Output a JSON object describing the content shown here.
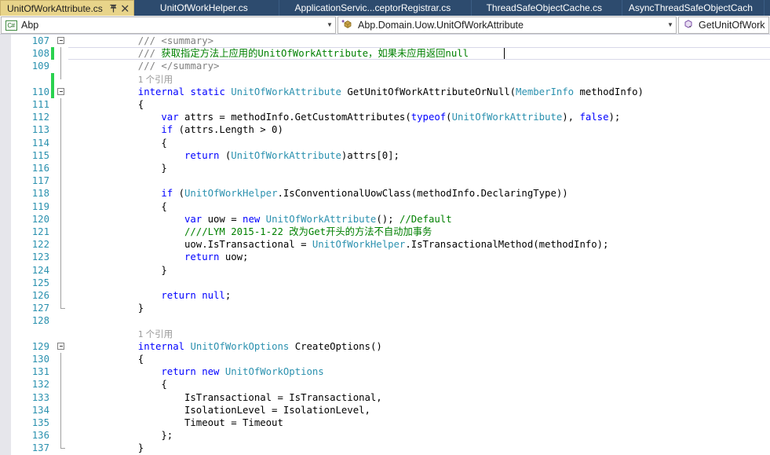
{
  "tabs": [
    {
      "label": "UnitOfWorkAttribute.cs",
      "active": true,
      "icons": [
        "pin-icon",
        "close-icon"
      ]
    },
    {
      "label": "UnitOfWorkHelper.cs",
      "active": false,
      "icons": []
    },
    {
      "label": "ApplicationServic...ceptorRegistrar.cs",
      "active": false,
      "icons": []
    },
    {
      "label": "ThreadSafeObjectCache.cs",
      "active": false,
      "icons": []
    },
    {
      "label": "AsyncThreadSafeObjectCach",
      "active": false,
      "icons": []
    }
  ],
  "navbar": {
    "namespace_combo": {
      "icon": "csharp-project-icon",
      "value": "Abp",
      "arrow": "▼"
    },
    "type_combo": {
      "icon": "class-icon",
      "value": "Abp.Domain.Uow.UnitOfWorkAttribute",
      "arrow": "▼"
    },
    "member_combo": {
      "icon": "method-icon",
      "value": "GetUnitOfWork",
      "arrow": "▼"
    }
  },
  "editor": {
    "language": "C#",
    "caret_line": 108,
    "codelens_label": "个引用",
    "codelens_count": "1",
    "lines": [
      {
        "n": "107",
        "indent": 12,
        "collapse": "minus",
        "rail": false,
        "change": false,
        "tokens": [
          {
            "t": "/// ",
            "c": "doc"
          },
          {
            "t": "<summary>",
            "c": "doc"
          }
        ]
      },
      {
        "n": "108",
        "indent": 12,
        "collapse": null,
        "rail": true,
        "change": true,
        "current": true,
        "tokens": [
          {
            "t": "/// ",
            "c": "doc"
          },
          {
            "t": "获取指定方法上应用的UnitOfWorkAttribute，如果未应用返回null",
            "c": "doctxt"
          }
        ]
      },
      {
        "n": "109",
        "indent": 12,
        "collapse": null,
        "rail": true,
        "change": false,
        "tokens": [
          {
            "t": "/// ",
            "c": "doc"
          },
          {
            "t": "</summary>",
            "c": "doc"
          }
        ]
      },
      {
        "n": "",
        "indent": 12,
        "collapse": null,
        "rail": "end",
        "change": true,
        "codelens": true,
        "tokens": []
      },
      {
        "n": "110",
        "indent": 12,
        "collapse": "minus",
        "rail": false,
        "change": true,
        "tokens": [
          {
            "t": "internal",
            "c": "kw"
          },
          {
            "t": " ",
            "c": "pln"
          },
          {
            "t": "static",
            "c": "kw"
          },
          {
            "t": " ",
            "c": "pln"
          },
          {
            "t": "UnitOfWorkAttribute",
            "c": "typ"
          },
          {
            "t": " GetUnitOfWorkAttributeOrNull(",
            "c": "pln"
          },
          {
            "t": "MemberInfo",
            "c": "typ"
          },
          {
            "t": " methodInfo)",
            "c": "pln"
          }
        ]
      },
      {
        "n": "111",
        "indent": 12,
        "collapse": null,
        "rail": true,
        "change": false,
        "tokens": [
          {
            "t": "{",
            "c": "pln"
          }
        ]
      },
      {
        "n": "112",
        "indent": 16,
        "collapse": null,
        "rail": true,
        "change": false,
        "tokens": [
          {
            "t": "var",
            "c": "kw"
          },
          {
            "t": " attrs = methodInfo.GetCustomAttributes(",
            "c": "pln"
          },
          {
            "t": "typeof",
            "c": "kw"
          },
          {
            "t": "(",
            "c": "pln"
          },
          {
            "t": "UnitOfWorkAttribute",
            "c": "typ"
          },
          {
            "t": "), ",
            "c": "pln"
          },
          {
            "t": "false",
            "c": "kw"
          },
          {
            "t": ");",
            "c": "pln"
          }
        ]
      },
      {
        "n": "113",
        "indent": 16,
        "collapse": null,
        "rail": true,
        "change": false,
        "tokens": [
          {
            "t": "if",
            "c": "kw"
          },
          {
            "t": " (attrs.Length > 0)",
            "c": "pln"
          }
        ]
      },
      {
        "n": "114",
        "indent": 16,
        "collapse": null,
        "rail": true,
        "change": false,
        "tokens": [
          {
            "t": "{",
            "c": "pln"
          }
        ]
      },
      {
        "n": "115",
        "indent": 20,
        "collapse": null,
        "rail": true,
        "change": false,
        "tokens": [
          {
            "t": "return",
            "c": "kw"
          },
          {
            "t": " (",
            "c": "pln"
          },
          {
            "t": "UnitOfWorkAttribute",
            "c": "typ"
          },
          {
            "t": ")attrs[0];",
            "c": "pln"
          }
        ]
      },
      {
        "n": "116",
        "indent": 16,
        "collapse": null,
        "rail": true,
        "change": false,
        "tokens": [
          {
            "t": "}",
            "c": "pln"
          }
        ]
      },
      {
        "n": "117",
        "indent": 0,
        "collapse": null,
        "rail": true,
        "change": false,
        "tokens": []
      },
      {
        "n": "118",
        "indent": 16,
        "collapse": null,
        "rail": true,
        "change": false,
        "tokens": [
          {
            "t": "if",
            "c": "kw"
          },
          {
            "t": " (",
            "c": "pln"
          },
          {
            "t": "UnitOfWorkHelper",
            "c": "typ"
          },
          {
            "t": ".IsConventionalUowClass(methodInfo.DeclaringType))",
            "c": "pln"
          }
        ]
      },
      {
        "n": "119",
        "indent": 16,
        "collapse": null,
        "rail": true,
        "change": false,
        "tokens": [
          {
            "t": "{",
            "c": "pln"
          }
        ]
      },
      {
        "n": "120",
        "indent": 20,
        "collapse": null,
        "rail": true,
        "change": false,
        "tokens": [
          {
            "t": "var",
            "c": "kw"
          },
          {
            "t": " uow = ",
            "c": "pln"
          },
          {
            "t": "new",
            "c": "kw"
          },
          {
            "t": " ",
            "c": "pln"
          },
          {
            "t": "UnitOfWorkAttribute",
            "c": "typ"
          },
          {
            "t": "(); ",
            "c": "pln"
          },
          {
            "t": "//Default",
            "c": "cmt"
          }
        ]
      },
      {
        "n": "121",
        "indent": 20,
        "collapse": null,
        "rail": true,
        "change": false,
        "tokens": [
          {
            "t": "////LYM 2015-1-22 改为Get开头的方法不自动加事务",
            "c": "cmt"
          }
        ]
      },
      {
        "n": "122",
        "indent": 20,
        "collapse": null,
        "rail": true,
        "change": false,
        "tokens": [
          {
            "t": "uow.IsTransactional = ",
            "c": "pln"
          },
          {
            "t": "UnitOfWorkHelper",
            "c": "typ"
          },
          {
            "t": ".IsTransactionalMethod(methodInfo);",
            "c": "pln"
          }
        ]
      },
      {
        "n": "123",
        "indent": 20,
        "collapse": null,
        "rail": true,
        "change": false,
        "tokens": [
          {
            "t": "return",
            "c": "kw"
          },
          {
            "t": " uow;",
            "c": "pln"
          }
        ]
      },
      {
        "n": "124",
        "indent": 16,
        "collapse": null,
        "rail": true,
        "change": false,
        "tokens": [
          {
            "t": "}",
            "c": "pln"
          }
        ]
      },
      {
        "n": "125",
        "indent": 0,
        "collapse": null,
        "rail": true,
        "change": false,
        "tokens": []
      },
      {
        "n": "126",
        "indent": 16,
        "collapse": null,
        "rail": true,
        "change": false,
        "tokens": [
          {
            "t": "return",
            "c": "kw"
          },
          {
            "t": " ",
            "c": "pln"
          },
          {
            "t": "null",
            "c": "kw"
          },
          {
            "t": ";",
            "c": "pln"
          }
        ]
      },
      {
        "n": "127",
        "indent": 12,
        "collapse": null,
        "rail": "endcap",
        "change": false,
        "tokens": [
          {
            "t": "}",
            "c": "pln"
          }
        ]
      },
      {
        "n": "128",
        "indent": 0,
        "collapse": null,
        "rail": false,
        "change": false,
        "tokens": []
      },
      {
        "n": "",
        "indent": 12,
        "collapse": null,
        "rail": false,
        "change": false,
        "codelens": true,
        "tokens": []
      },
      {
        "n": "129",
        "indent": 12,
        "collapse": "minus",
        "rail": false,
        "change": false,
        "tokens": [
          {
            "t": "internal",
            "c": "kw"
          },
          {
            "t": " ",
            "c": "pln"
          },
          {
            "t": "UnitOfWorkOptions",
            "c": "typ"
          },
          {
            "t": " CreateOptions()",
            "c": "pln"
          }
        ]
      },
      {
        "n": "130",
        "indent": 12,
        "collapse": null,
        "rail": true,
        "change": false,
        "tokens": [
          {
            "t": "{",
            "c": "pln"
          }
        ]
      },
      {
        "n": "131",
        "indent": 16,
        "collapse": null,
        "rail": true,
        "change": false,
        "tokens": [
          {
            "t": "return",
            "c": "kw"
          },
          {
            "t": " ",
            "c": "pln"
          },
          {
            "t": "new",
            "c": "kw"
          },
          {
            "t": " ",
            "c": "pln"
          },
          {
            "t": "UnitOfWorkOptions",
            "c": "typ"
          }
        ]
      },
      {
        "n": "132",
        "indent": 16,
        "collapse": null,
        "rail": true,
        "change": false,
        "tokens": [
          {
            "t": "{",
            "c": "pln"
          }
        ]
      },
      {
        "n": "133",
        "indent": 20,
        "collapse": null,
        "rail": true,
        "change": false,
        "tokens": [
          {
            "t": "IsTransactional = IsTransactional,",
            "c": "pln"
          }
        ]
      },
      {
        "n": "134",
        "indent": 20,
        "collapse": null,
        "rail": true,
        "change": false,
        "tokens": [
          {
            "t": "IsolationLevel = IsolationLevel,",
            "c": "pln"
          }
        ]
      },
      {
        "n": "135",
        "indent": 20,
        "collapse": null,
        "rail": true,
        "change": false,
        "tokens": [
          {
            "t": "Timeout = Timeout",
            "c": "pln"
          }
        ]
      },
      {
        "n": "136",
        "indent": 16,
        "collapse": null,
        "rail": true,
        "change": false,
        "tokens": [
          {
            "t": "};",
            "c": "pln"
          }
        ]
      },
      {
        "n": "137",
        "indent": 12,
        "collapse": null,
        "rail": "endcap",
        "change": false,
        "tokens": [
          {
            "t": "}",
            "c": "pln"
          }
        ]
      }
    ]
  },
  "colors": {
    "active_tab_bg": "#e8d48a",
    "inactive_tab_bg": "#2d4b6e",
    "keyword": "#0000ff",
    "type": "#2b91af",
    "comment": "#008000",
    "line_number": "#2b91af",
    "change_bar": "#2ad14f"
  }
}
